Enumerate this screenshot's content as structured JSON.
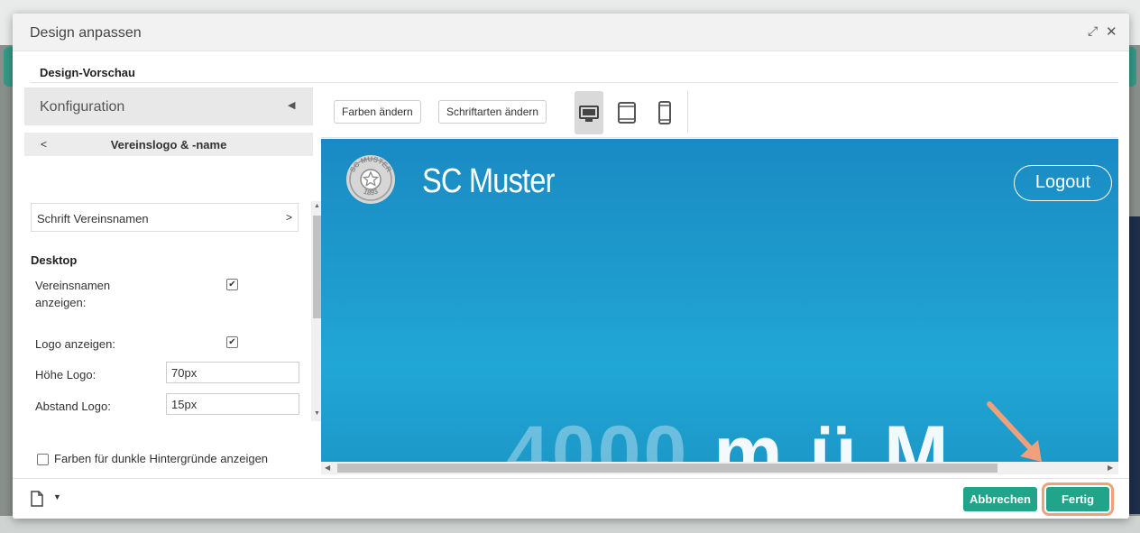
{
  "dialog": {
    "title": "Design anpassen",
    "section_title": "Design-Vorschau"
  },
  "sidebar": {
    "config_label": "Konfiguration",
    "back_label": "<",
    "subtitle": "Vereinslogo & -name",
    "font_row_label": "Schrift Vereinsnamen",
    "font_row_arrow": ">",
    "group_title": "Desktop",
    "show_name_label": "Vereinsnamen anzeigen:",
    "show_name_checked": true,
    "show_logo_label": "Logo anzeigen:",
    "show_logo_checked": true,
    "logo_height_label": "Höhe Logo:",
    "logo_height_value": "70px",
    "logo_spacing_label": "Abstand Logo:",
    "logo_spacing_value": "15px",
    "dark_colors_label": "Farben für dunkle Hintergründe anzeigen",
    "dark_colors_checked": false
  },
  "toolbar": {
    "colors_button": "Farben ändern",
    "fonts_button": "Schriftarten ändern",
    "devices": [
      "desktop-icon",
      "tablet-icon",
      "mobile-icon"
    ],
    "active_device": "desktop"
  },
  "preview": {
    "logo_text_top": "SC MUSTER",
    "logo_text_bottom": "1893",
    "club_name": "SC Muster",
    "logout_label": "Logout"
  },
  "footer": {
    "cancel_label": "Abbrechen",
    "done_label": "Fertig"
  },
  "colors": {
    "accent": "#20a48a",
    "preview_bg": "#1e9ccd",
    "highlight": "#f0a07a"
  }
}
